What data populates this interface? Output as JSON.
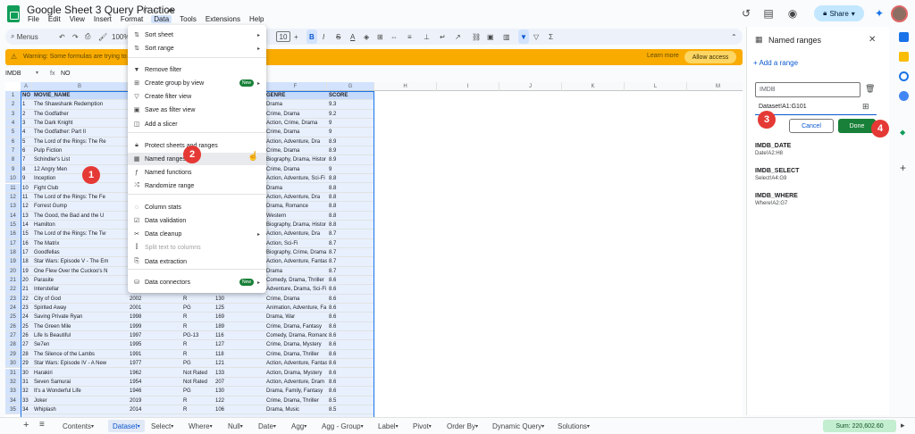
{
  "window": {
    "doc_title": "Google Sheet 3 Query Practice",
    "menus": [
      "File",
      "Edit",
      "View",
      "Insert",
      "Format",
      "Data",
      "Tools",
      "Extensions",
      "Help"
    ],
    "share_label": "Share"
  },
  "toolbar": {
    "menus_label": "Menus",
    "zoom": "100%",
    "font_size": "10"
  },
  "warning": {
    "text": "Warning: Some formulas are trying to send and receive data from external parties.",
    "learn_more": "Learn more",
    "allow_access": "Allow access"
  },
  "formula_bar": {
    "name_box": "IMDB",
    "fx": "fx",
    "value": "NO"
  },
  "grid": {
    "columns": [
      "A",
      "B",
      "C",
      "D",
      "E",
      "F",
      "G",
      "H",
      "I",
      "J",
      "K",
      "L",
      "M",
      "N"
    ],
    "headers": {
      "no": "NO",
      "movie": "MOVIE_NAME",
      "genre": "GENRE",
      "score": "SCORE"
    },
    "rows": [
      {
        "n": "1",
        "no": "1",
        "movie": "The Shawshank Redemption",
        "genre": "Drama",
        "score": "9.3"
      },
      {
        "n": "2",
        "no": "2",
        "movie": "The Godfather",
        "genre": "Crime, Drama",
        "score": "9.2"
      },
      {
        "n": "3",
        "no": "3",
        "movie": "The Dark Knight",
        "genre": "Action, Crime, Drama",
        "score": "9"
      },
      {
        "n": "4",
        "no": "4",
        "movie": "The Godfather: Part II",
        "genre": "Crime, Drama",
        "score": "9"
      },
      {
        "n": "5",
        "no": "5",
        "movie": "The Lord of the Rings: The Re",
        "genre": "Action, Adventure, Dra",
        "score": "8.9"
      },
      {
        "n": "6",
        "no": "6",
        "movie": "Pulp Fiction",
        "genre": "Crime, Drama",
        "score": "8.9"
      },
      {
        "n": "7",
        "no": "7",
        "movie": "Schindler's List",
        "genre": "Biography, Drama, Histor",
        "score": "8.9"
      },
      {
        "n": "8",
        "no": "8",
        "movie": "12 Angry Men",
        "genre": "Crime, Drama",
        "score": "9"
      },
      {
        "n": "9",
        "no": "9",
        "movie": "Inception",
        "genre": "Action, Adventure, Sci-Fi",
        "score": "8.8"
      },
      {
        "n": "10",
        "no": "10",
        "movie": "Fight Club",
        "genre": "Drama",
        "score": "8.8"
      },
      {
        "n": "11",
        "no": "11",
        "movie": "The Lord of the Rings: The Fe",
        "genre": "Action, Adventure, Dra",
        "score": "8.8"
      },
      {
        "n": "12",
        "no": "12",
        "movie": "Forrest Gump",
        "genre": "Drama, Romance",
        "score": "8.8"
      },
      {
        "n": "13",
        "no": "13",
        "movie": "The Good, the Bad and the U",
        "genre": "Western",
        "score": "8.8"
      },
      {
        "n": "14",
        "no": "14",
        "movie": "Hamilton",
        "genre": "Biography, Drama, Histor",
        "score": "8.8"
      },
      {
        "n": "15",
        "no": "15",
        "movie": "The Lord of the Rings: The Tw",
        "genre": "Action, Adventure, Dra",
        "score": "8.7"
      },
      {
        "n": "16",
        "no": "16",
        "movie": "The Matrix",
        "genre": "Action, Sci-Fi",
        "score": "8.7"
      },
      {
        "n": "17",
        "no": "17",
        "movie": "Goodfellas",
        "genre": "Biography, Crime, Drama",
        "score": "8.7"
      },
      {
        "n": "18",
        "no": "18",
        "movie": "Star Wars: Episode V - The Em",
        "genre": "Action, Adventure, Fantas",
        "score": "8.7"
      },
      {
        "n": "19",
        "no": "19",
        "movie": "One Flew Over the Cuckoo's N",
        "genre": "Drama",
        "score": "8.7"
      },
      {
        "n": "20",
        "no": "20",
        "movie": "Parasite",
        "genre": "Comedy, Drama, Thriller",
        "score": "8.6"
      },
      {
        "n": "21",
        "no": "21",
        "movie": "Interstellar",
        "genre": "Adventure, Drama, Sci-Fi",
        "score": "8.6"
      },
      {
        "n": "22",
        "no": "22",
        "movie": "City of God",
        "year": "2002",
        "rating": "R",
        "dur": "130",
        "genre": "Crime, Drama",
        "score": "8.6"
      },
      {
        "n": "23",
        "no": "23",
        "movie": "Spirited Away",
        "year": "2001",
        "rating": "PG",
        "dur": "125",
        "genre": "Animation, Adventure, Fa",
        "score": "8.6"
      },
      {
        "n": "24",
        "no": "24",
        "movie": "Saving Private Ryan",
        "year": "1998",
        "rating": "R",
        "dur": "169",
        "genre": "Drama, War",
        "score": "8.6"
      },
      {
        "n": "25",
        "no": "25",
        "movie": "The Green Mile",
        "year": "1999",
        "rating": "R",
        "dur": "189",
        "genre": "Crime, Drama, Fantasy",
        "score": "8.6"
      },
      {
        "n": "26",
        "no": "26",
        "movie": "Life Is Beautiful",
        "year": "1997",
        "rating": "PG-13",
        "dur": "116",
        "genre": "Comedy, Drama, Romance",
        "score": "8.6"
      },
      {
        "n": "27",
        "no": "27",
        "movie": "Se7en",
        "year": "1995",
        "rating": "R",
        "dur": "127",
        "genre": "Crime, Drama, Mystery",
        "score": "8.6"
      },
      {
        "n": "28",
        "no": "28",
        "movie": "The Silence of the Lambs",
        "year": "1991",
        "rating": "R",
        "dur": "118",
        "genre": "Crime, Drama, Thriller",
        "score": "8.6"
      },
      {
        "n": "29",
        "no": "29",
        "movie": "Star Wars: Episode IV - A New",
        "year": "1977",
        "rating": "PG",
        "dur": "121",
        "genre": "Action, Adventure, Fantas",
        "score": "8.6"
      },
      {
        "n": "30",
        "no": "30",
        "movie": "Harakiri",
        "year": "1962",
        "rating": "Not Rated",
        "dur": "133",
        "genre": "Action, Drama, Mystery",
        "score": "8.6"
      },
      {
        "n": "31",
        "no": "31",
        "movie": "Seven Samurai",
        "year": "1954",
        "rating": "Not Rated",
        "dur": "207",
        "genre": "Action, Adventure, Dram",
        "score": "8.6"
      },
      {
        "n": "32",
        "no": "32",
        "movie": "It's a Wonderful Life",
        "year": "1946",
        "rating": "PG",
        "dur": "130",
        "genre": "Drama, Family, Fantasy",
        "score": "8.6"
      },
      {
        "n": "33",
        "no": "33",
        "movie": "Joker",
        "year": "2019",
        "rating": "R",
        "dur": "122",
        "genre": "Crime, Drama, Thriller",
        "score": "8.5"
      },
      {
        "n": "34",
        "no": "34",
        "movie": "Whiplash",
        "year": "2014",
        "rating": "R",
        "dur": "106",
        "genre": "Drama, Music",
        "score": "8.5"
      }
    ]
  },
  "data_menu": {
    "items": [
      {
        "label": "Sort sheet",
        "icon": "sort-icon",
        "arrow": true
      },
      {
        "label": "Sort range",
        "icon": "sort-range-icon",
        "arrow": true
      },
      {
        "label": "Remove filter",
        "icon": "filter-icon"
      },
      {
        "label": "Create group by view",
        "icon": "group-icon",
        "arrow": true,
        "badge": "New"
      },
      {
        "label": "Create filter view",
        "icon": "filter-view-icon"
      },
      {
        "label": "Save as filter view",
        "icon": "save-icon"
      },
      {
        "label": "Add a slicer",
        "icon": "slicer-icon"
      },
      {
        "label": "Protect sheets and ranges",
        "icon": "lock-icon"
      },
      {
        "label": "Named ranges",
        "icon": "named-range-icon"
      },
      {
        "label": "Named functions",
        "icon": "function-icon"
      },
      {
        "label": "Randomize range",
        "icon": "shuffle-icon"
      },
      {
        "label": "Column stats",
        "icon": "bulb-icon"
      },
      {
        "label": "Data validation",
        "icon": "validation-icon"
      },
      {
        "label": "Data cleanup",
        "icon": "cleanup-icon",
        "arrow": true
      },
      {
        "label": "Split text to columns",
        "icon": "split-icon",
        "disabled": true
      },
      {
        "label": "Data extraction",
        "icon": "extract-icon"
      },
      {
        "label": "Data connectors",
        "icon": "database-icon",
        "arrow": true,
        "badge": "New"
      }
    ]
  },
  "badges": [
    "1",
    "2",
    "3",
    "4"
  ],
  "panel": {
    "title": "Named ranges",
    "add_range": "+ Add a range",
    "name_value": "IMDB",
    "range_value": "Dataset!A1:G101",
    "cancel": "Cancel",
    "done": "Done",
    "ranges": [
      {
        "name": "IMDB_DATE",
        "range": "Date!A2:H8"
      },
      {
        "name": "IMDB_SELECT",
        "range": "Select!A4:G9"
      },
      {
        "name": "IMDB_WHERE",
        "range": "Where!A2:G7"
      }
    ]
  },
  "tabs": [
    "Contents",
    "Dataset",
    "Select",
    "Where",
    "Null",
    "Date",
    "Agg",
    "Agg - Group",
    "Label",
    "Pivot",
    "Order By",
    "Dynamic Query",
    "Solutions"
  ],
  "active_tab": "Dataset",
  "sum_label": "Sum: 220,602.60",
  "colors": {
    "accent": "#0b57d0",
    "green": "#188038",
    "warning": "#f9ab00",
    "badge": "#e53935"
  }
}
